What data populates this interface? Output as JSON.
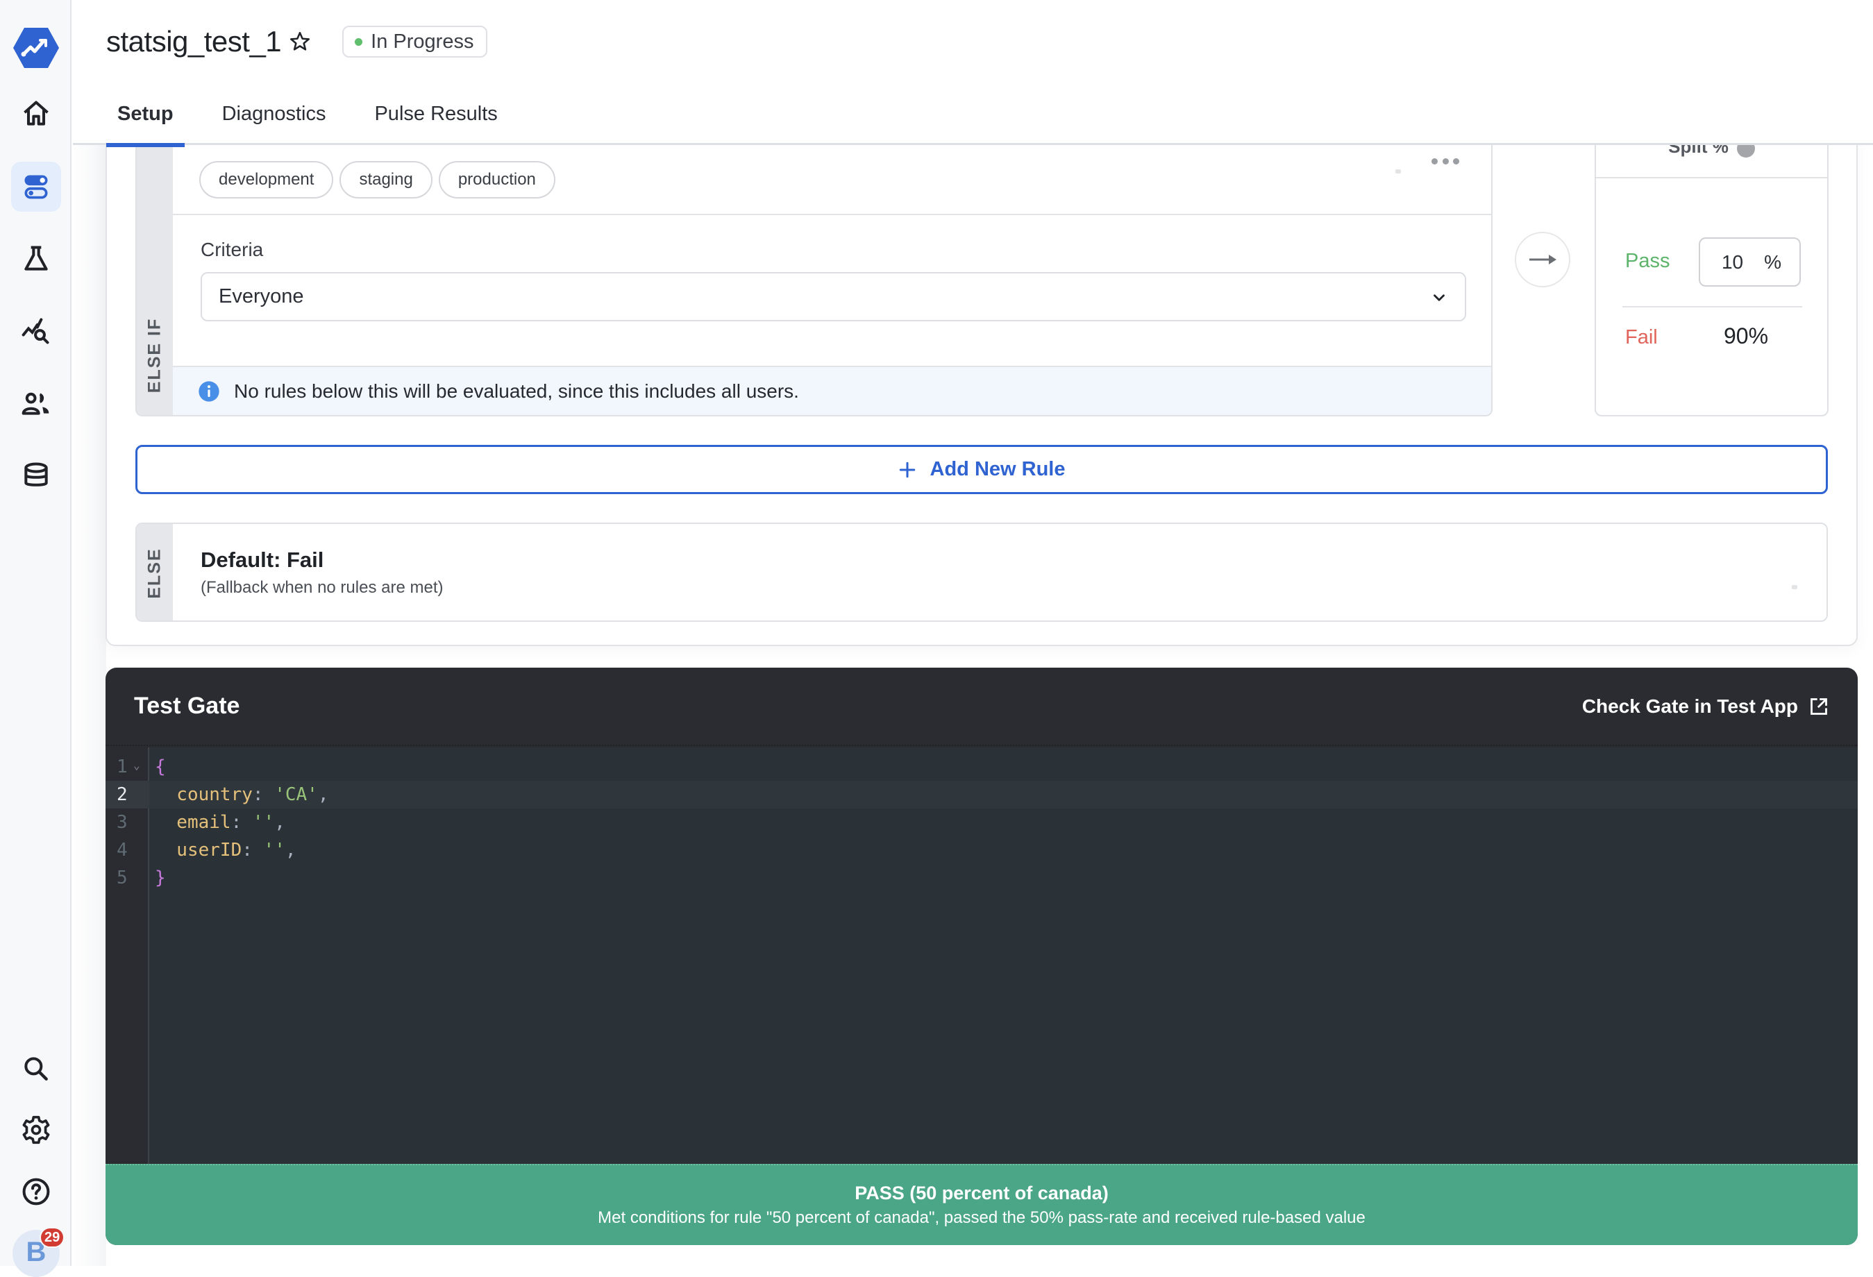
{
  "app": {
    "brand_color": "#2f63d1",
    "sidebar": {
      "items": [
        {
          "name": "home",
          "icon": "home-icon"
        },
        {
          "name": "feature-gates",
          "icon": "toggle-icon",
          "active": true
        },
        {
          "name": "experiments",
          "icon": "flask-icon"
        },
        {
          "name": "analytics",
          "icon": "chart-search-icon"
        },
        {
          "name": "users",
          "icon": "users-icon"
        },
        {
          "name": "data",
          "icon": "database-icon"
        }
      ],
      "bottom_items": [
        {
          "name": "search",
          "icon": "search-icon"
        },
        {
          "name": "settings",
          "icon": "gear-icon"
        },
        {
          "name": "help",
          "icon": "help-icon"
        }
      ],
      "avatar_initial": "B",
      "notification_count": "29"
    }
  },
  "header": {
    "title": "statsig_test_1",
    "status": "In Progress",
    "status_color": "#5fbf6c",
    "tabs": [
      {
        "label": "Setup",
        "active": true
      },
      {
        "label": "Diagnostics",
        "active": false
      },
      {
        "label": "Pulse Results",
        "active": false
      }
    ]
  },
  "rule": {
    "type_label": "ELSE IF",
    "environments": [
      "development",
      "staging",
      "production"
    ],
    "criteria_label": "Criteria",
    "criteria_value": "Everyone",
    "info_message": "No rules below this will be evaluated, since this includes all users.",
    "split": {
      "header": "Split %",
      "pass_label": "Pass",
      "pass_value": "10",
      "pass_unit": "%",
      "fail_label": "Fail",
      "fail_value": "90%"
    }
  },
  "add_rule_label": "Add New Rule",
  "default_rule": {
    "type_label": "ELSE",
    "title": "Default: Fail",
    "subtitle": "(Fallback when no rules are met)"
  },
  "test_gate": {
    "title": "Test Gate",
    "link_label": "Check Gate in Test App",
    "active_line": 2,
    "code_lines": [
      {
        "n": "1",
        "tokens": [
          {
            "t": "{",
            "c": "brace"
          }
        ],
        "fold": true
      },
      {
        "n": "2",
        "tokens": [
          {
            "t": "  country",
            "c": "key"
          },
          {
            "t": ": ",
            "c": "punc"
          },
          {
            "t": "'CA'",
            "c": "str"
          },
          {
            "t": ",",
            "c": "punc"
          }
        ]
      },
      {
        "n": "3",
        "tokens": [
          {
            "t": "  email",
            "c": "key"
          },
          {
            "t": ": ",
            "c": "punc"
          },
          {
            "t": "''",
            "c": "str"
          },
          {
            "t": ",",
            "c": "punc"
          }
        ]
      },
      {
        "n": "4",
        "tokens": [
          {
            "t": "  userID",
            "c": "key"
          },
          {
            "t": ": ",
            "c": "punc"
          },
          {
            "t": "''",
            "c": "str"
          },
          {
            "t": ",",
            "c": "punc"
          }
        ]
      },
      {
        "n": "5",
        "tokens": [
          {
            "t": "}",
            "c": "brace"
          }
        ]
      }
    ],
    "result": {
      "title": "PASS (50 percent of canada)",
      "description": "Met conditions for rule \"50 percent of canada\", passed the 50% pass-rate and received rule-based value",
      "color": "#4ba688"
    }
  }
}
